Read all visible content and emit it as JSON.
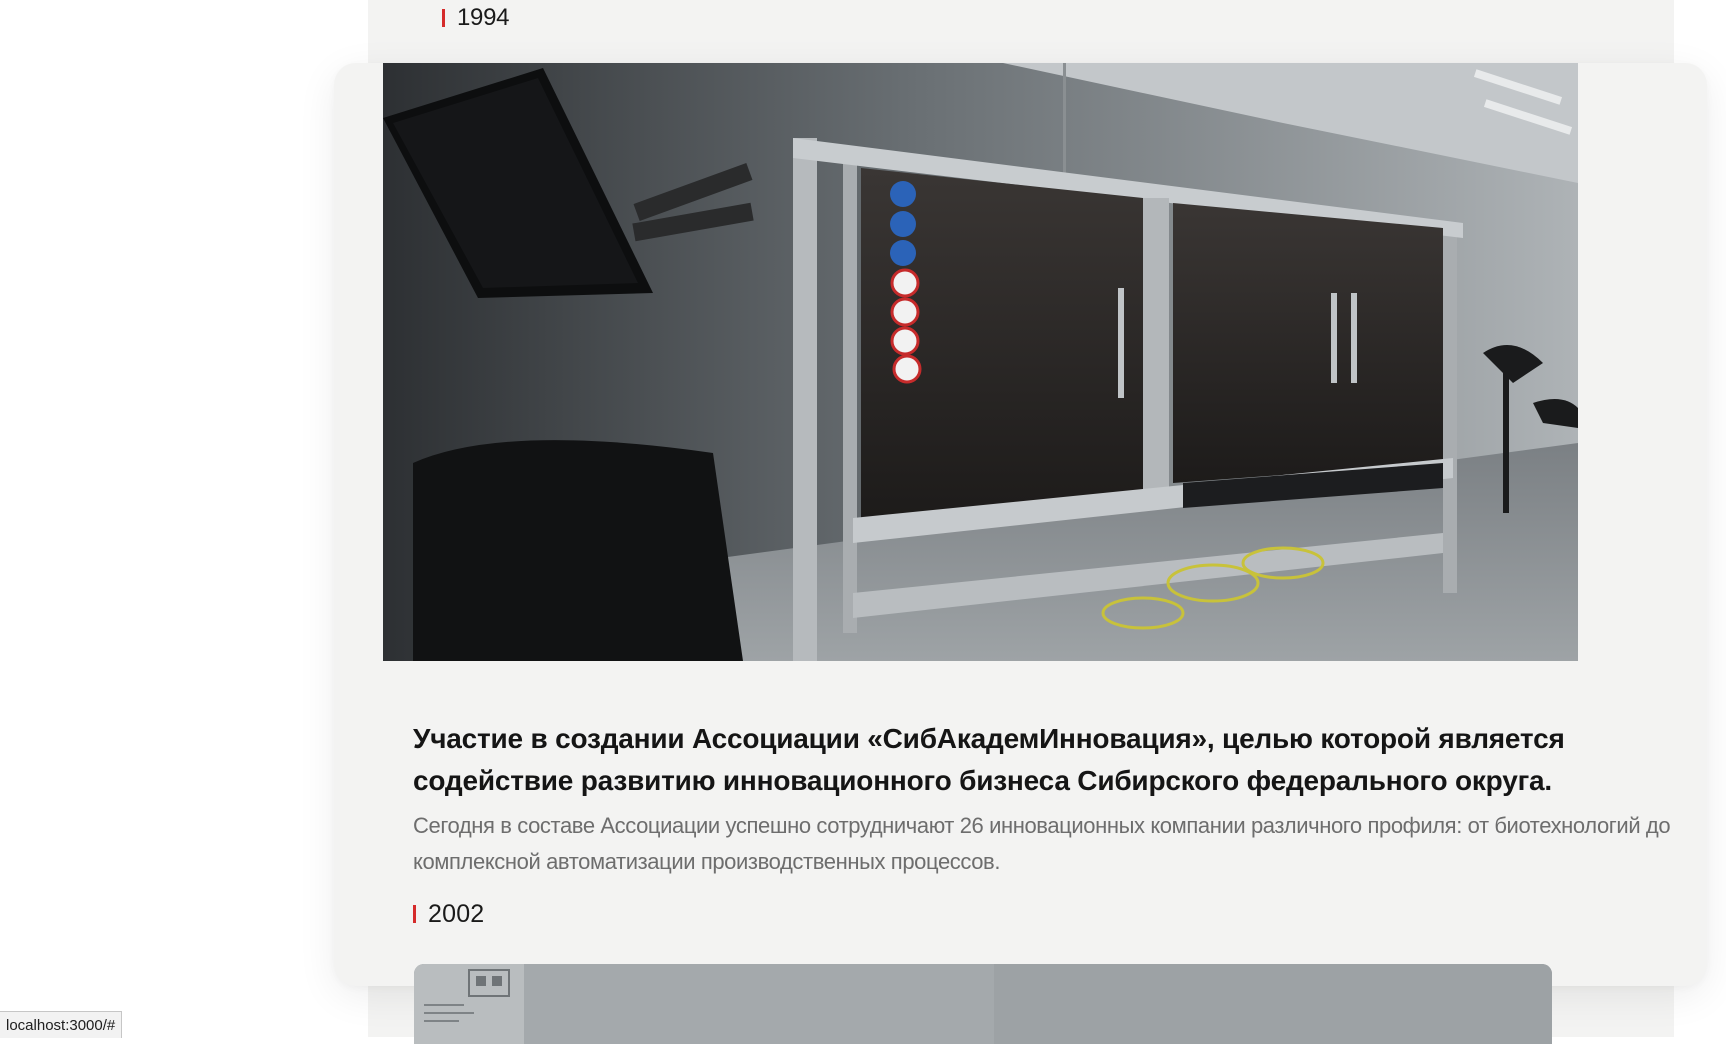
{
  "timeline": {
    "previous_year": "1994",
    "active_item": {
      "headline": "Участие в создании Ассоциации «СибАкадемИнновация», целью которой является содействие развитию инновационного бизнеса Сибирского федерального округа.",
      "description": "Сегодня в составе Ассоциации успешно сотрудничают 26 инновационных компании различного профиля: от биотехнологий до комплексной автоматизации производственных процессов.",
      "photo": "cleanroom-automation-equipment-photo"
    },
    "next_year": "2002",
    "next_photo": "lab-document-photo"
  },
  "status_bar": {
    "url": "localhost:3000/#"
  },
  "colors": {
    "accent": "#d52b2b",
    "card_bg": "#f3f3f2",
    "headline": "#151515",
    "description": "#6d6d6d"
  }
}
